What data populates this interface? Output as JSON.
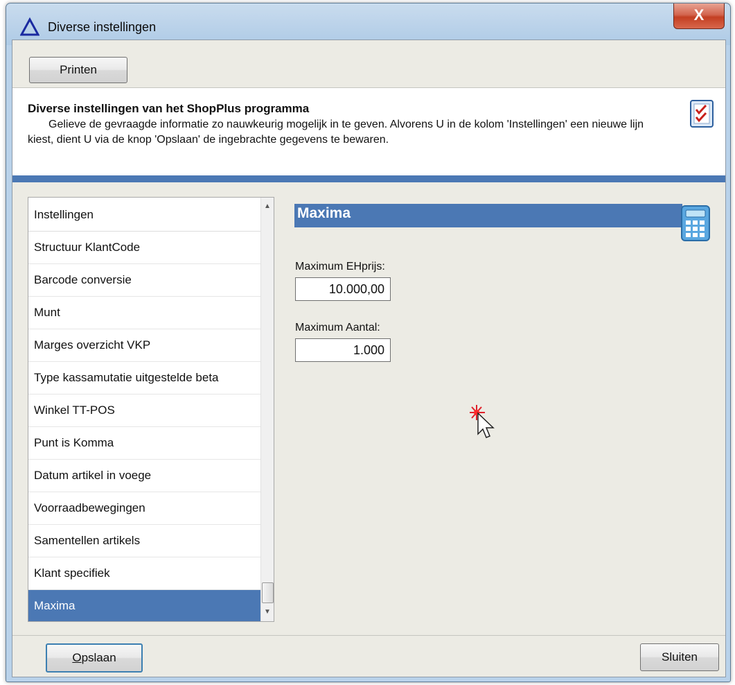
{
  "window": {
    "title": "Diverse instellingen",
    "close_label": "X"
  },
  "toolbar": {
    "print_label": "Printen"
  },
  "header": {
    "title": "Diverse instellingen van het ShopPlus programma",
    "description": "Gelieve de gevraagde informatie zo nauwkeurig mogelijk in te geven. Alvorens U in de kolom 'Instellingen' een nieuwe lijn kiest, dient U via de knop 'Opslaan' de ingebrachte gegevens te bewaren."
  },
  "settings_list": {
    "header": "Instellingen",
    "items": [
      "Structuur KlantCode",
      "Barcode conversie",
      "Munt",
      "Marges overzicht VKP",
      "Type kassamutatie uitgestelde beta",
      "Winkel TT-POS",
      "Punt is Komma",
      "Datum artikel in voege",
      "Voorraadbewegingen",
      "Samentellen artikels",
      "Klant specifiek",
      "Maxima"
    ],
    "selected": "Maxima"
  },
  "panel": {
    "title": "Maxima",
    "max_unit_price_label": "Maximum EHprijs:",
    "max_unit_price_value": "10.000,00",
    "max_quantity_label": "Maximum Aantal:",
    "max_quantity_value": "1.000"
  },
  "footer": {
    "save_label_first": "O",
    "save_label_rest": "pslaan",
    "close_label": "Sluiten"
  },
  "colors": {
    "accent": "#4b78b4",
    "selected_row": "#4b78b4",
    "close_button": "#c33f22"
  },
  "icons": {
    "app_icon": "triangle-icon",
    "header_icon": "checklist-icon",
    "panel_icon": "calculator-icon"
  }
}
